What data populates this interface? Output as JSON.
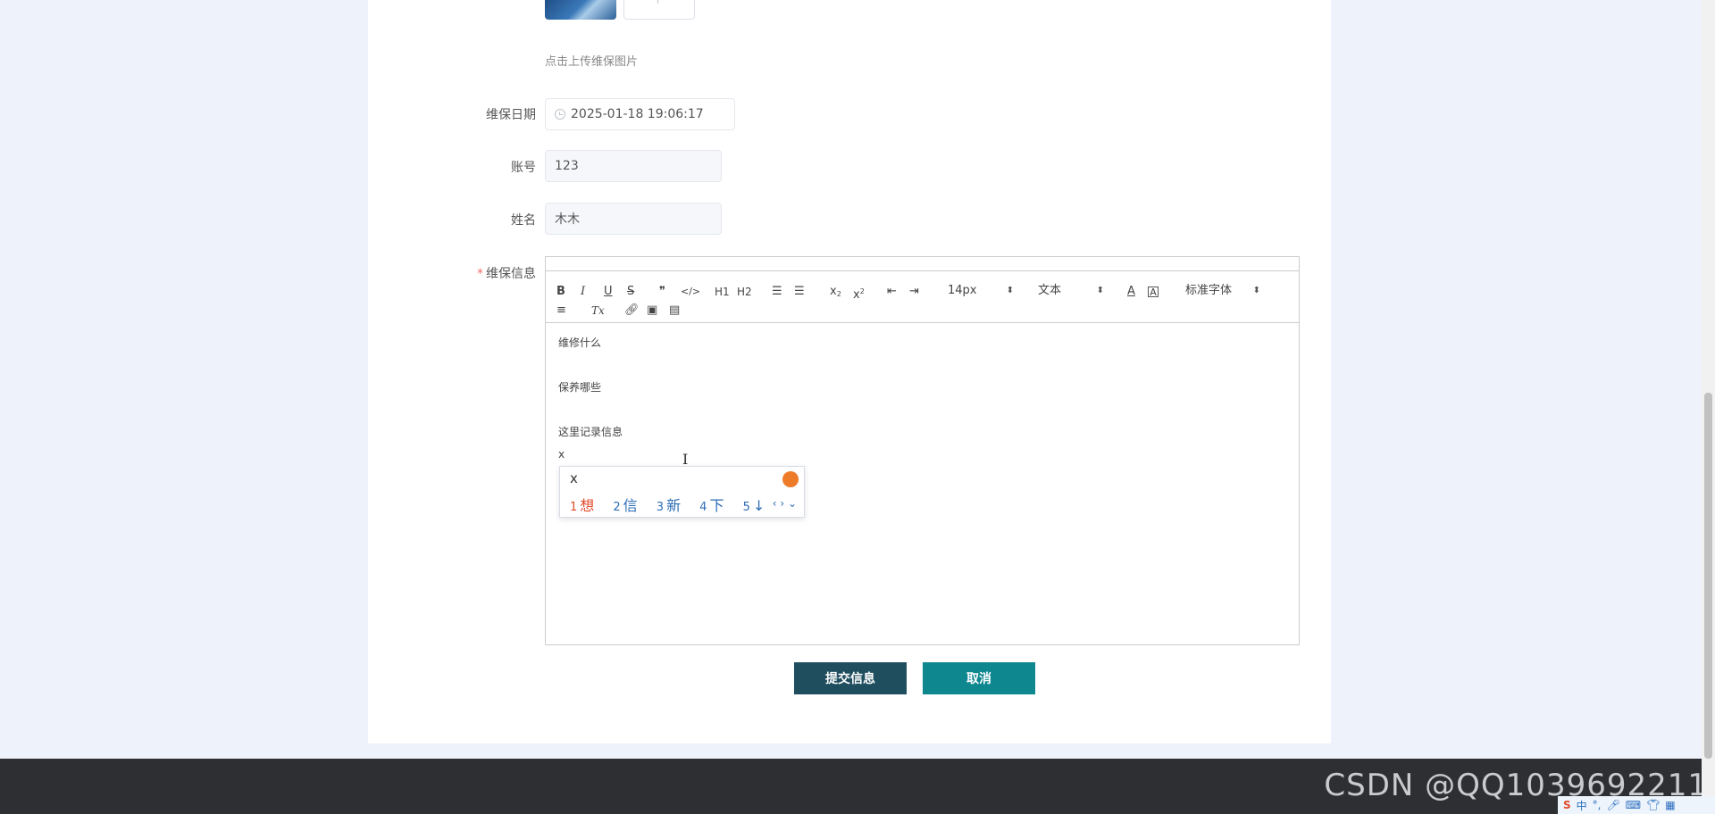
{
  "upload": {
    "hint": "点击上传维保图片"
  },
  "form": {
    "date_label": "维保日期",
    "date_value": "2025-01-18 19:06:17",
    "account_label": "账号",
    "account_value": "123",
    "name_label": "姓名",
    "name_value": "木木",
    "info_label": "维保信息",
    "required_mark": "*"
  },
  "editor": {
    "toolbar": {
      "bold": "B",
      "italic": "I",
      "underline": "U",
      "strike": "S",
      "quote": "❞",
      "code": "</>",
      "h1": "H1",
      "h2": "H2",
      "x_sub": "x",
      "sub2": "2",
      "x_sup": "x",
      "sup2": "2",
      "font_size": "14px",
      "text_type": "文本",
      "font_family": "标准字体",
      "clear_format": "Tx"
    },
    "content": [
      "维修什么",
      "保养哪些",
      "这里记录信息"
    ],
    "current_input": "x"
  },
  "ime": {
    "composition": "x",
    "candidates": [
      {
        "num": "1",
        "text": "想"
      },
      {
        "num": "2",
        "text": "信"
      },
      {
        "num": "3",
        "text": "新"
      },
      {
        "num": "4",
        "text": "下"
      },
      {
        "num": "5",
        "text": "↓"
      }
    ]
  },
  "buttons": {
    "submit": "提交信息",
    "cancel": "取消"
  },
  "watermark": "CSDN @QQ1039692211",
  "tray": {
    "cn": "中",
    "punct": "°,"
  }
}
